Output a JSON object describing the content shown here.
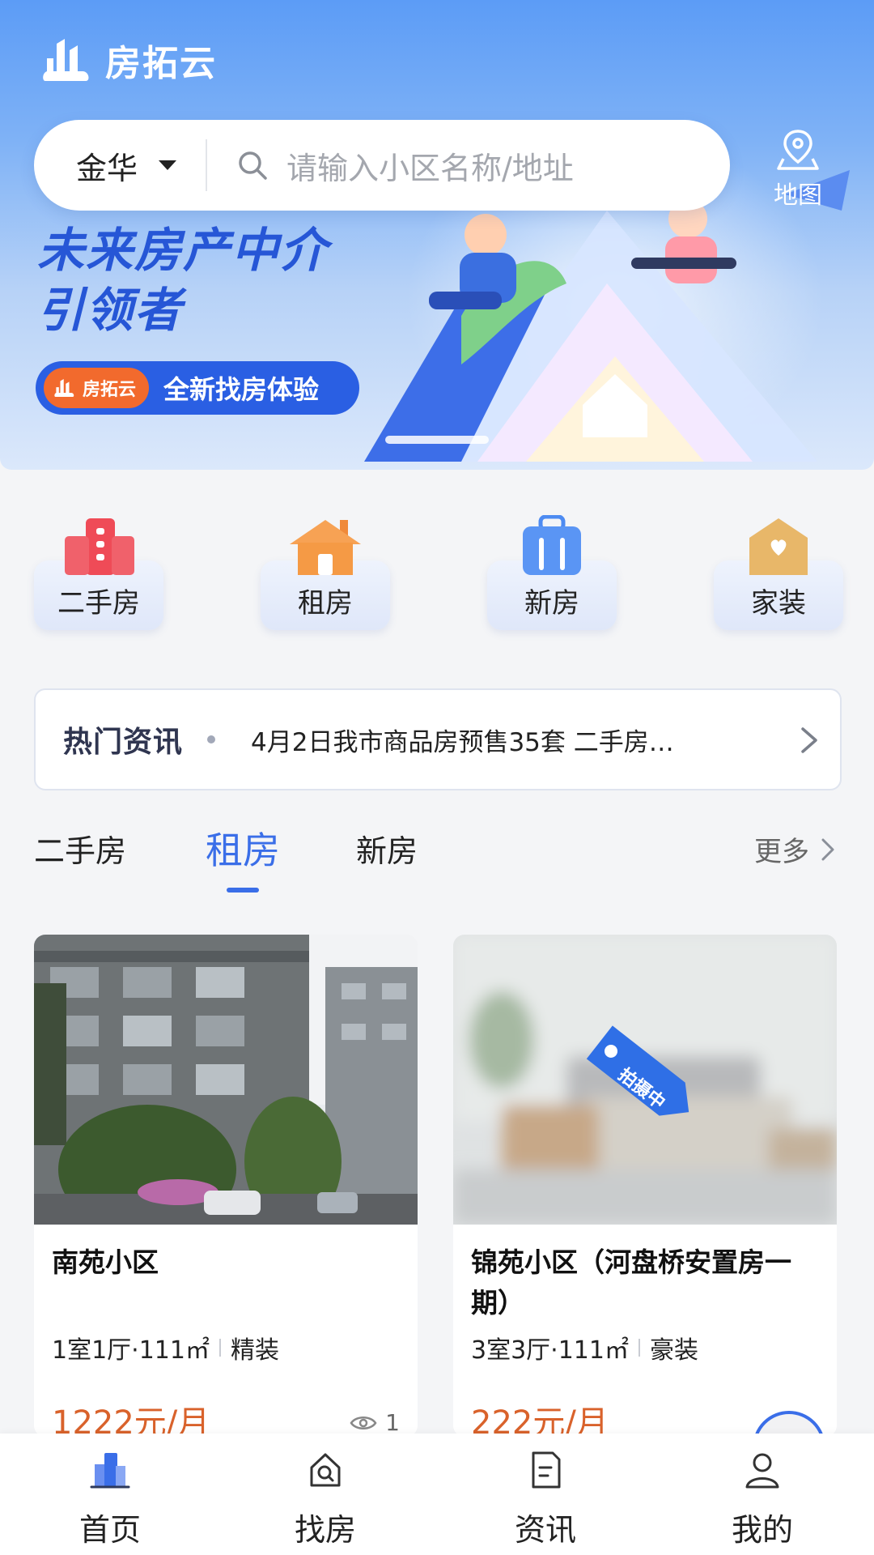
{
  "app": {
    "name": "房拓云"
  },
  "search": {
    "city": "金华",
    "placeholder": "请输入小区名称/地址"
  },
  "map_button": {
    "label": "地图"
  },
  "banner": {
    "slogan_line1": "未来房产中介",
    "slogan_line2": "引领者",
    "pill_brand": "房拓云",
    "pill_text": "全新找房体验"
  },
  "categories": [
    {
      "label": "二手房",
      "icon": "building-icon"
    },
    {
      "label": "租房",
      "icon": "house-icon"
    },
    {
      "label": "新房",
      "icon": "bag-building-icon"
    },
    {
      "label": "家装",
      "icon": "heart-house-icon"
    }
  ],
  "news": {
    "title": "热门资讯",
    "headline": "4月2日我市商品房预售35套 二手房…"
  },
  "tabs": {
    "items": [
      "二手房",
      "租房",
      "新房"
    ],
    "active": "租房",
    "more": "更多"
  },
  "listings": [
    {
      "name": "南苑小区",
      "layout": "1室1厅·111㎡",
      "decoration": "精装",
      "price": "1222元/月",
      "views": "1"
    },
    {
      "name": "锦苑小区（河盘桥安置房一期）",
      "layout": "3室3厅·111㎡",
      "decoration": "豪装",
      "price": "222元/月",
      "badge": "拍摄中"
    }
  ],
  "bottom_nav": [
    {
      "label": "首页",
      "icon": "home-building-icon",
      "active": true
    },
    {
      "label": "找房",
      "icon": "find-house-icon"
    },
    {
      "label": "资讯",
      "icon": "news-doc-icon"
    },
    {
      "label": "我的",
      "icon": "user-icon"
    }
  ],
  "colors": {
    "accent": "#3a6ee8",
    "price": "#d9622b",
    "banner_blue": "#2656d6",
    "brand_orange": "#f26a2d"
  }
}
